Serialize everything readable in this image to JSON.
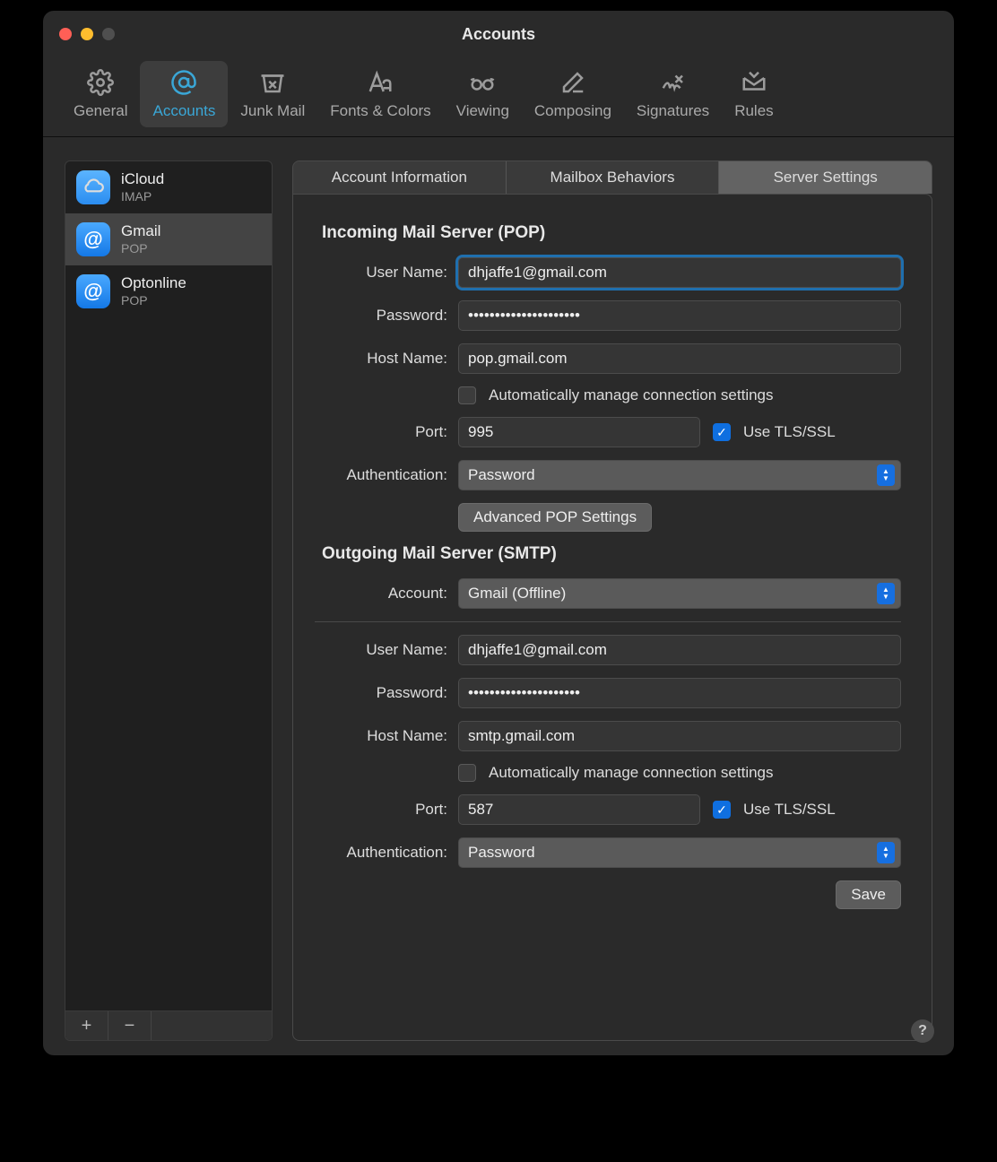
{
  "window": {
    "title": "Accounts"
  },
  "toolbar": {
    "items": [
      {
        "label": "General"
      },
      {
        "label": "Accounts"
      },
      {
        "label": "Junk Mail"
      },
      {
        "label": "Fonts & Colors"
      },
      {
        "label": "Viewing"
      },
      {
        "label": "Composing"
      },
      {
        "label": "Signatures"
      },
      {
        "label": "Rules"
      }
    ]
  },
  "sidebar": {
    "accounts": [
      {
        "name": "iCloud",
        "type": "IMAP"
      },
      {
        "name": "Gmail",
        "type": "POP"
      },
      {
        "name": "Optonline",
        "type": "POP"
      }
    ],
    "add": "+",
    "remove": "−"
  },
  "tabs": {
    "items": [
      {
        "label": "Account Information"
      },
      {
        "label": "Mailbox Behaviors"
      },
      {
        "label": "Server Settings"
      }
    ]
  },
  "incoming": {
    "title": "Incoming Mail Server (POP)",
    "username_label": "User Name:",
    "username": "dhjaffe1@gmail.com",
    "password_label": "Password:",
    "password": "•••••••••••••••••••••",
    "hostname_label": "Host Name:",
    "hostname": "pop.gmail.com",
    "auto_label": "Automatically manage connection settings",
    "port_label": "Port:",
    "port": "995",
    "tls_label": "Use TLS/SSL",
    "auth_label": "Authentication:",
    "auth_value": "Password",
    "advanced_btn": "Advanced POP Settings"
  },
  "outgoing": {
    "title": "Outgoing Mail Server (SMTP)",
    "account_label": "Account:",
    "account_value": "Gmail (Offline)",
    "username_label": "User Name:",
    "username": "dhjaffe1@gmail.com",
    "password_label": "Password:",
    "password": "•••••••••••••••••••••",
    "hostname_label": "Host Name:",
    "hostname": "smtp.gmail.com",
    "auto_label": "Automatically manage connection settings",
    "port_label": "Port:",
    "port": "587",
    "tls_label": "Use TLS/SSL",
    "auth_label": "Authentication:",
    "auth_value": "Password"
  },
  "actions": {
    "save": "Save",
    "help": "?"
  }
}
